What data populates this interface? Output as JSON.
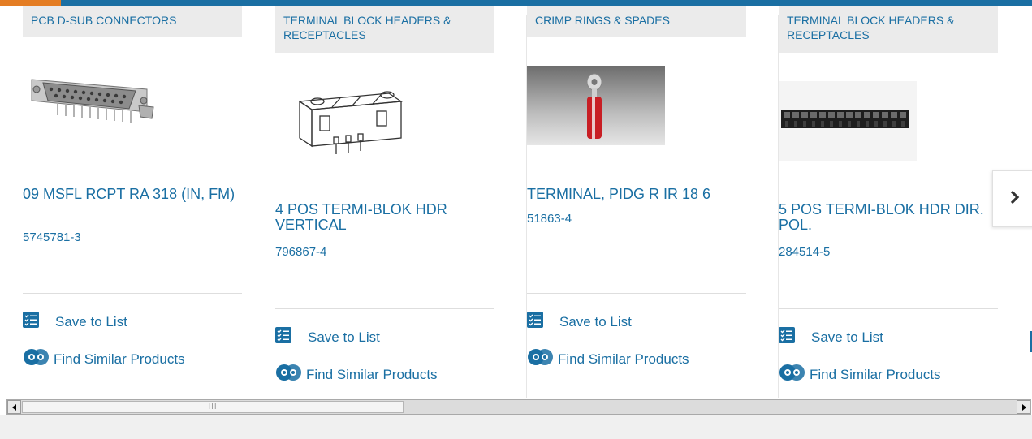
{
  "colors": {
    "accent_blue": "#1a6fa3",
    "accent_orange": "#e47d23"
  },
  "products": [
    {
      "category": "PCB D-SUB CONNECTORS",
      "name": "09 MSFL RCPT RA 318 (IN, FM)",
      "part_number": "5745781-3",
      "image": "d-sub-connector-image",
      "save_label": "Save to List",
      "similar_label": "Find Similar Products"
    },
    {
      "category": "TERMINAL BLOCK HEADERS & RECEPTACLES",
      "name": "4 POS TERMI-BLOK HDR VERTICAL",
      "part_number": "796867-4",
      "image": "terminal-block-header-image",
      "save_label": "Save to List",
      "similar_label": "Find Similar Products"
    },
    {
      "category": "CRIMP RINGS & SPADES",
      "name": "TERMINAL, PIDG R IR 18 6",
      "part_number": "51863-4",
      "image": "ring-terminal-image",
      "save_label": "Save to List",
      "similar_label": "Find Similar Products"
    },
    {
      "category": "TERMINAL BLOCK HEADERS & RECEPTACLES",
      "name": "5 POS TERMI-BLOK HDR DIR. POL.",
      "part_number": "284514-5",
      "image": "terminal-block-black-image",
      "save_label": "Save to List",
      "similar_label": "Find Similar Products"
    }
  ],
  "carousel": {
    "next_icon": "chevron-right-icon"
  },
  "scrollbar": {
    "left_icon": "arrow-left-icon",
    "right_icon": "arrow-right-icon",
    "grip": "III"
  }
}
